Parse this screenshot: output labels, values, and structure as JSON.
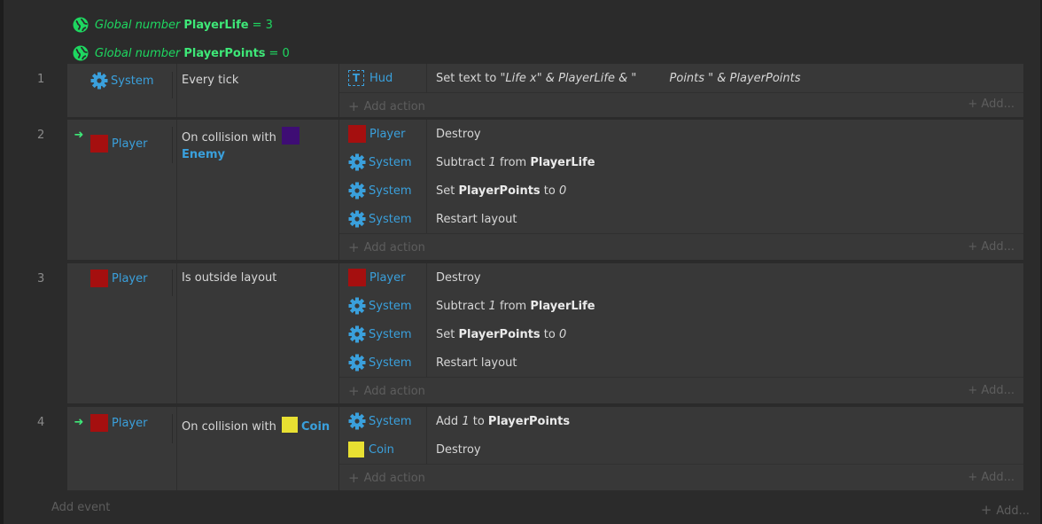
{
  "globals": [
    {
      "prefix": "Global number",
      "name": "PlayerLife",
      "eq": "= 3"
    },
    {
      "prefix": "Global number",
      "name": "PlayerPoints",
      "eq": "= 0"
    }
  ],
  "events": [
    {
      "number": "1",
      "condition": {
        "object": "System",
        "text": "Every tick"
      },
      "actions": [
        {
          "object": "Hud",
          "text_a": "Set text to ",
          "text_b": "\"Life x\" & PlayerLife & \"         Points \" & PlayerPoints"
        }
      ]
    },
    {
      "number": "2",
      "condition": {
        "object": "Player",
        "text": "On collision with",
        "target": "Enemy"
      },
      "actions": [
        {
          "object": "Player",
          "text": "Destroy"
        },
        {
          "object": "System",
          "pre": "Subtract ",
          "num": "1",
          "mid": " from ",
          "var": "PlayerLife"
        },
        {
          "object": "System",
          "pre": "Set ",
          "var": "PlayerPoints",
          "mid": " to ",
          "num": "0"
        },
        {
          "object": "System",
          "text": "Restart layout"
        }
      ]
    },
    {
      "number": "3",
      "condition": {
        "object": "Player",
        "text": "Is outside layout"
      },
      "actions": [
        {
          "object": "Player",
          "text": "Destroy"
        },
        {
          "object": "System",
          "pre": "Subtract ",
          "num": "1",
          "mid": " from ",
          "var": "PlayerLife"
        },
        {
          "object": "System",
          "pre": "Set ",
          "var": "PlayerPoints",
          "mid": " to ",
          "num": "0"
        },
        {
          "object": "System",
          "text": "Restart layout"
        }
      ]
    },
    {
      "number": "4",
      "condition": {
        "object": "Player",
        "text": "On collision with",
        "target": "Coin"
      },
      "actions": [
        {
          "object": "System",
          "pre": "Add ",
          "num": "1",
          "mid": " to ",
          "var": "PlayerPoints"
        },
        {
          "object": "Coin",
          "text": "Destroy"
        }
      ]
    }
  ],
  "labels": {
    "add_action": "Add action",
    "add": "Add...",
    "add_event": "Add event"
  },
  "colors": {
    "object_blue": "#3aa0dc",
    "global_green": "#1ed760",
    "player_red": "#a50f0f",
    "enemy_purple": "#3e0d74",
    "coin_yellow": "#e8e032"
  },
  "icons": {
    "global": "globe-icon",
    "system": "gear-icon",
    "text": "text-object-icon",
    "trigger": "trigger-arrow-icon",
    "add": "plus-icon"
  }
}
